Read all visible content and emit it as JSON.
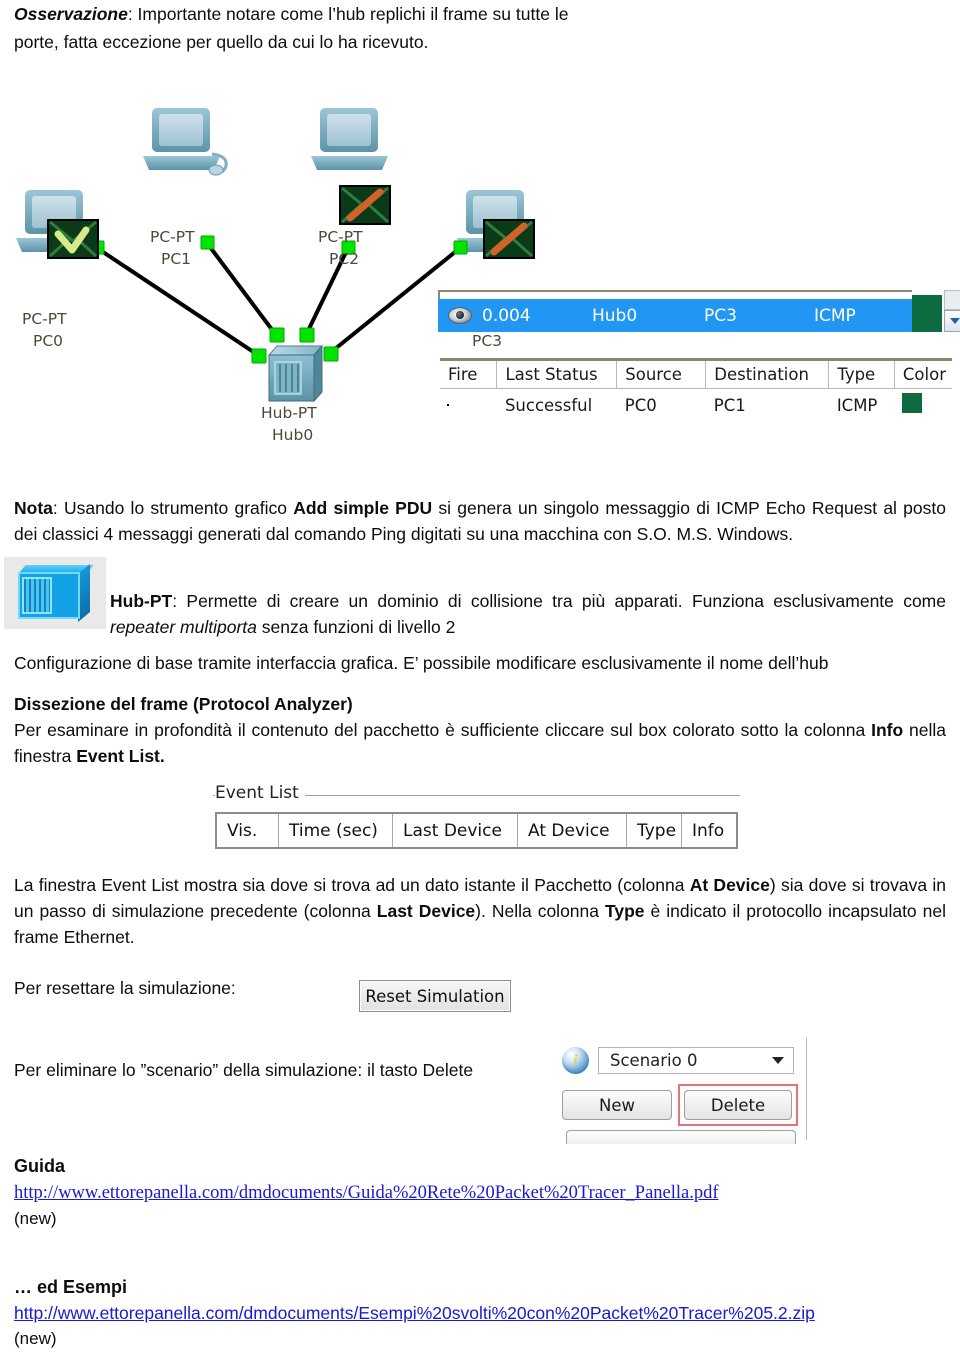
{
  "intro": {
    "label_bold": "Osservazione",
    "text": ": Importante notare come l’hub replichi il frame su tutte le porte, fatta eccezione per quello da cui lo ha ricevuto."
  },
  "diagram": {
    "nodes": [
      {
        "id": "pc1",
        "type_label": "PC-PT",
        "name": "PC1",
        "envelope": "none"
      },
      {
        "id": "pc2",
        "type_label": "PC-PT",
        "name": "PC2",
        "envelope": "icmp-request"
      },
      {
        "id": "pc0",
        "type_label": "PC-PT",
        "name": "PC0",
        "envelope": "icmp-reply"
      },
      {
        "id": "pc3",
        "type_label": "PC-PT",
        "name": "PC3",
        "envelope": "icmp-request"
      },
      {
        "id": "hub0",
        "type_label": "Hub-PT",
        "name": "Hub0",
        "envelope": "none"
      }
    ],
    "links": [
      {
        "from": "pc0",
        "to": "hub0"
      },
      {
        "from": "pc1",
        "to": "hub0"
      },
      {
        "from": "pc2",
        "to": "hub0"
      },
      {
        "from": "pc3",
        "to": "hub0"
      }
    ],
    "link_status_color": "#00e000"
  },
  "event_strip": {
    "selected_row": {
      "vis_icon": "eye-icon",
      "time": "0.004",
      "last_device": "Hub0",
      "at_device": "PC3",
      "type": "ICMP",
      "color": "#0c6b3f"
    },
    "selection_color": "#2196f3",
    "scrollbar": {
      "down_arrow": "chevron-down-icon"
    }
  },
  "pdu_table": {
    "headers": [
      "Fire",
      "Last Status",
      "Source",
      "Destination",
      "Type",
      "Color"
    ],
    "rows": [
      {
        "fire": "red-led-icon",
        "last_status": "Successful",
        "source": "PC0",
        "destination": "PC1",
        "type": "ICMP",
        "color": "#0c6b3f"
      }
    ]
  },
  "nota": {
    "label_bold": "Nota",
    "part1": ": Usando lo strumento grafico ",
    "bold1": "Add simple PDU",
    "part2": " si genera un singolo messaggio di ICMP Echo Request al posto dei classici 4 messaggi generati dal comando Ping digitati su una macchina con S.O. M.S. Windows."
  },
  "hub": {
    "icon_name": "hub-pt-icon",
    "bold": "Hub-PT",
    "part1": ": Permette di creare un dominio di collisione tra più apparati. Funziona esclusivamente come ",
    "italic1": "repeater multiporta",
    "part2": " senza funzioni di livello 2",
    "line2": "Configurazione di base tramite interfaccia grafica. E’ possibile modificare esclusivamente il nome dell’hub"
  },
  "dissezione": {
    "heading": "Dissezione del frame (Protocol Analyzer)",
    "part1": "Per esaminare in profondità il contenuto del pacchetto è sufficiente cliccare sul box colorato sotto la colonna ",
    "bold1": "Info",
    "part2": " nella finestra ",
    "bold2": "Event List."
  },
  "event_panel": {
    "caption": "Event List",
    "columns": [
      "Vis.",
      "Time (sec)",
      "Last Device",
      "At Device",
      "Type",
      "Info"
    ]
  },
  "event_explanation": {
    "part1": "La finestra Event List mostra sia dove si trova ad un dato istante il Pacchetto (colonna ",
    "bold1": "At Device",
    "part2": ") sia dove si trovava in un passo di simulazione precedente (colonna ",
    "bold2": "Last Device",
    "part3": "). Nella colonna ",
    "bold3": "Type",
    "part4": " è indicato il protocollo incapsulato nel frame Ethernet."
  },
  "reset": {
    "label": "Per resettare la simulazione:",
    "button": "Reset Simulation"
  },
  "scenario": {
    "label": "Per eliminare lo ”scenario” della simulazione:  il tasto Delete",
    "info_icon": "info-icon",
    "selected": "Scenario 0",
    "new_button": "New",
    "delete_button": "Delete",
    "highlight_color": "#e0757d"
  },
  "links": {
    "guida_heading": "Guida",
    "guida_url": "http://www.ettorepanella.com/dmdocuments/Guida%20Rete%20Packet%20Tracer_Panella.pdf",
    "guida_note": "(new)",
    "esempi_heading": "… ed Esempi",
    "esempi_url": "http://www.ettorepanella.com/dmdocuments/Esempi%20svolti%20con%20Packet%20Tracer%205.2.zip",
    "esempi_note": "(new)"
  }
}
